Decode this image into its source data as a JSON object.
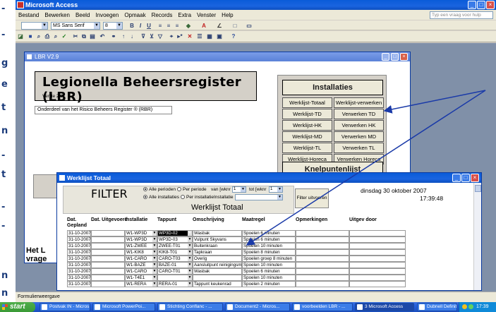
{
  "slide_strip": {
    "fragments": [
      "-",
      "-",
      "g",
      "e",
      "t",
      "n",
      "-",
      "t",
      "-",
      "-",
      "n",
      "n"
    ]
  },
  "access": {
    "title": "Microsoft Access",
    "menu": [
      "Bestand",
      "Bewerken",
      "Beeld",
      "Invoegen",
      "Opmaak",
      "Records",
      "Extra",
      "Venster",
      "Help"
    ],
    "help_placeholder": "Typ een vraag voor hulp",
    "font_name": "MS Sans Serif",
    "font_size": "8",
    "status": "Formulierweergave"
  },
  "lbr": {
    "window_title": "LBR V2.9",
    "main_title": "Legionella Beheersregister (LBR)",
    "version": "Versie 2.9",
    "subtitle": "Onderdeel van het Risico Beheers Register ®  (RBR)",
    "installaties_header": "Installaties",
    "buttons": [
      [
        "Werklijst-Totaal",
        "Werklijst-verwerken"
      ],
      [
        "Werklijst-TD",
        "Verwerken TD"
      ],
      [
        "Werklijst-HK",
        "Verwerken HK"
      ],
      [
        "Werklijst-MD",
        "Verwerken MD"
      ],
      [
        "Werklijst-TL",
        "Verwerken TL"
      ],
      [
        "Werklijst-Horeca",
        "Verwerken Horeca"
      ]
    ],
    "knelpunten_header": "Knelpuntenlijst",
    "footer_text_1": "Het L",
    "footer_text_2": "vrage"
  },
  "werklijst": {
    "window_title": "Werklijst Totaal",
    "filter_label": "FILTER",
    "opt_alle_perioden": "Alle perioden",
    "opt_per_periode": "Per periode",
    "opt_van": "van [wknr",
    "opt_tot": "tot [wknr",
    "opt_alle_installaties": "Alle installaties",
    "opt_per_installatie": "Per installatie",
    "opt_installatie": "Installatie",
    "van_value": "1",
    "tot_value": "1",
    "filter_button": "Filter uitvoeren",
    "heading": "Werklijst Totaal",
    "date": "dinsdag 30 oktober 2007",
    "time": "17:39:48",
    "columns": [
      "Dat. Gepland",
      "Dat. Uitgevoerd",
      "Installatie",
      "Tappunt",
      "Omschrijving",
      "Maatregel",
      "Opmerkingen",
      "Uitgev door"
    ],
    "rows": [
      [
        "31-10-2007",
        "",
        "W1-WP3D",
        "WP3D-02",
        "Wasbak",
        "Spoelen 6 minuten",
        "",
        ""
      ],
      [
        "31-10-2007",
        "",
        "W1-WP3D",
        "WP3D-03",
        "Vulpunt Skyvans",
        "Spoelen 6 minuten",
        "",
        ""
      ],
      [
        "31-10-2007",
        "",
        "W1-ZWEE",
        "ZWEE-T01",
        "Buitenkraan",
        "Spoelen 10 minuten",
        "",
        ""
      ],
      [
        "31-10-2007",
        "",
        "W1-KIK8",
        "KIK8-T01",
        "Tapkraan",
        "Spoelen 8 minuten",
        "",
        ""
      ],
      [
        "31-10-2007",
        "",
        "W1-CARO",
        "CARO-T03",
        "Overig",
        "Spoelen groep 8 minuten",
        "",
        ""
      ],
      [
        "31-10-2007",
        "",
        "W1-BAZE",
        "BAZE-01",
        "Aansluitpunt reinigingsm",
        "Spoelen 10 minuten",
        "",
        ""
      ],
      [
        "31-10-2007",
        "",
        "W1-CARO",
        "CARO-T01",
        "Wasbak",
        "Spoelen 6 minuten",
        "",
        ""
      ],
      [
        "31-10-2007",
        "",
        "W1-T4E1",
        "",
        "",
        "Spoelen 10 minuten",
        "",
        ""
      ],
      [
        "31-10-2007",
        "",
        "W1-RERA",
        "RERA-01",
        "Tappunt keukenrad",
        "Spoelen 2 minuten",
        "",
        ""
      ]
    ]
  },
  "taskbar": {
    "start": "start",
    "tasks": [
      "Postvak IN - Micros...",
      "Microsoft PowerPoi...",
      "Stichting Conflanc - ...",
      "Document2 - Micros...",
      "voorbeelden LBR - ...",
      "3 Microsoft Access",
      "Dubnell Definitief"
    ],
    "clock": "17:39"
  }
}
